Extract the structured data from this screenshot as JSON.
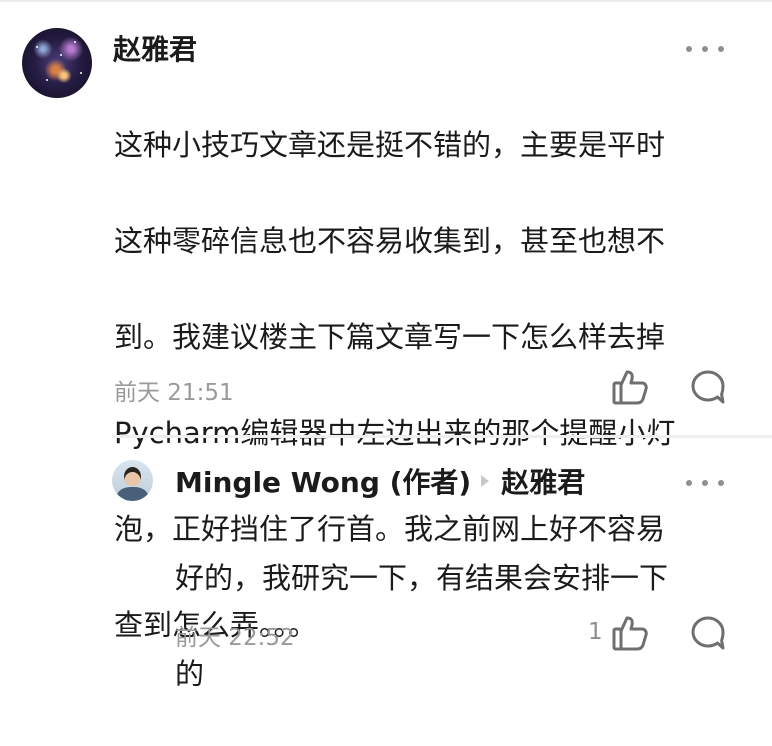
{
  "comment": {
    "author": "赵雅君",
    "lines": [
      "这种小技巧文章还是挺不错的，主要是平时",
      "这种零碎信息也不容易收集到，甚至也想不",
      "到。我建议楼主下篇文章写一下怎么样去掉",
      "Pycharm编辑器中左边出来的那个提醒小灯",
      "泡，正好挡住了行首。我之前网上好不容易",
      "查到怎么弄。。。"
    ],
    "time": "前天 21:51"
  },
  "reply": {
    "author": "Mingle Wong (作者)",
    "reply_to": "赵雅君",
    "lines": [
      "好的，我研究一下，有结果会安排一下",
      "的"
    ],
    "time": "前天 22:52",
    "like_count": "1"
  },
  "icons": {
    "more": "more-icon",
    "like": "thumbs-up-icon",
    "comment": "comment-bubble-icon"
  },
  "colors": {
    "text": "#1b1b1b",
    "meta": "#9a9a9a",
    "icon": "#6f6f6f"
  }
}
